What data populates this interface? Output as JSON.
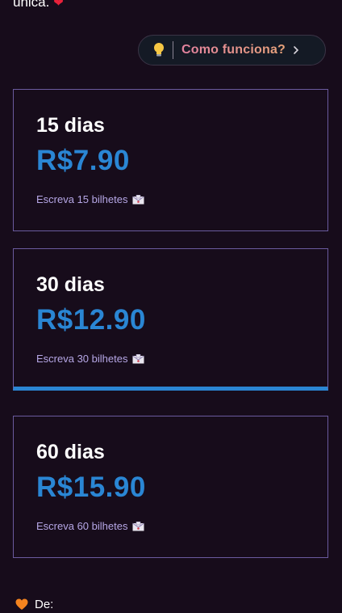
{
  "header": {
    "top_text": "única."
  },
  "how_button": {
    "label": "Como funciona?",
    "icon": "lightbulb-icon",
    "chevron": "chevron-right-icon"
  },
  "plans": [
    {
      "duration": "15 dias",
      "price": "R$7.90",
      "description": "Escreva 15 bilhetes",
      "selected": false
    },
    {
      "duration": "30 dias",
      "price": "R$12.90",
      "description": "Escreva 30 bilhetes",
      "selected": true
    },
    {
      "duration": "60 dias",
      "price": "R$15.90",
      "description": "Escreva 60 bilhetes",
      "selected": false
    }
  ],
  "from": {
    "label": "De:",
    "icon": "orange-heart-icon"
  },
  "colors": {
    "background": "#170c1b",
    "accent_blue": "#2a86d4",
    "card_border": "#6a5a9e",
    "description_text": "#b6a7e6"
  }
}
